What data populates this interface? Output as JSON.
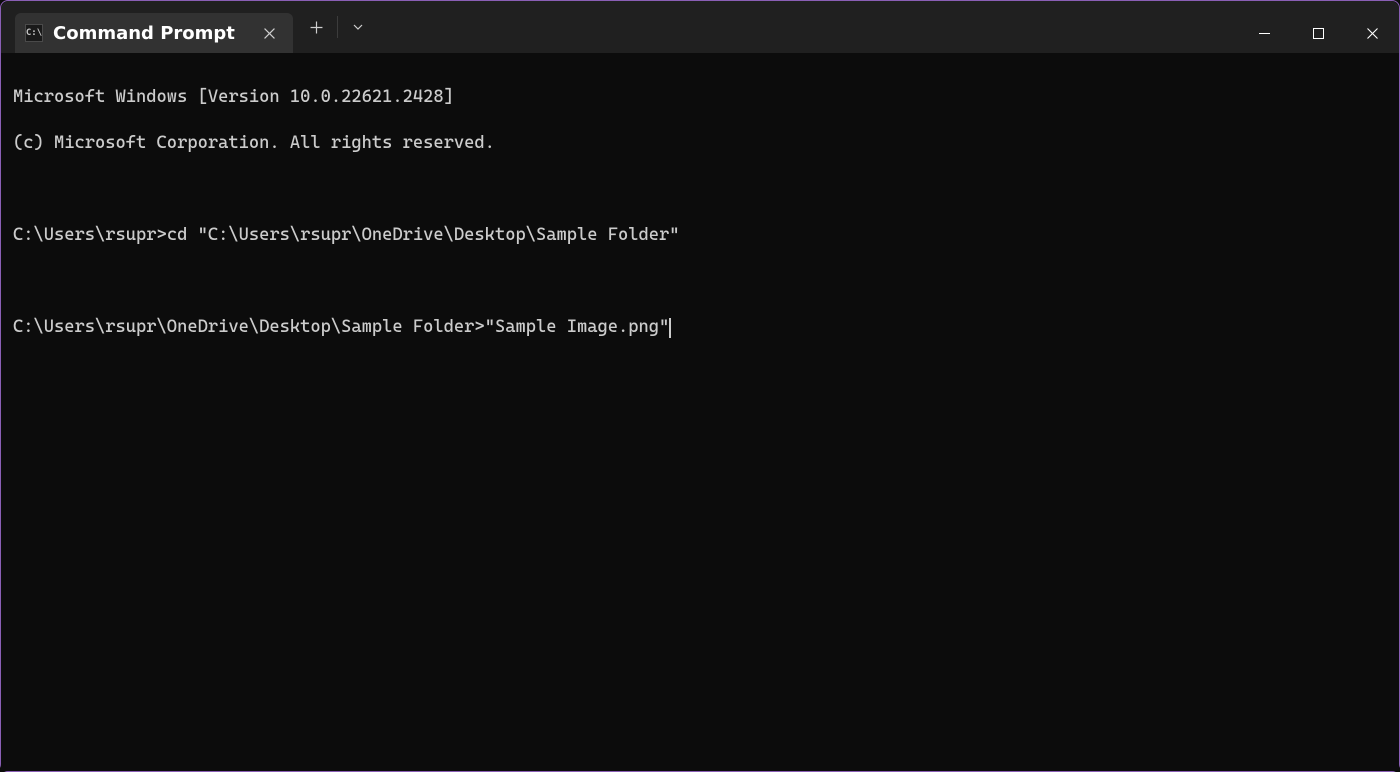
{
  "titlebar": {
    "tab": {
      "title": "Command Prompt"
    }
  },
  "terminal": {
    "header_line_1": "Microsoft Windows [Version 10.0.22621.2428]",
    "header_line_2": "(c) Microsoft Corporation. All rights reserved.",
    "history": [
      {
        "prompt": "C:\\Users\\rsupr>",
        "command": "cd \"C:\\Users\\rsupr\\OneDrive\\Desktop\\Sample Folder\""
      }
    ],
    "current": {
      "prompt": "C:\\Users\\rsupr\\OneDrive\\Desktop\\Sample Folder>",
      "command": "\"Sample Image.png\""
    }
  }
}
